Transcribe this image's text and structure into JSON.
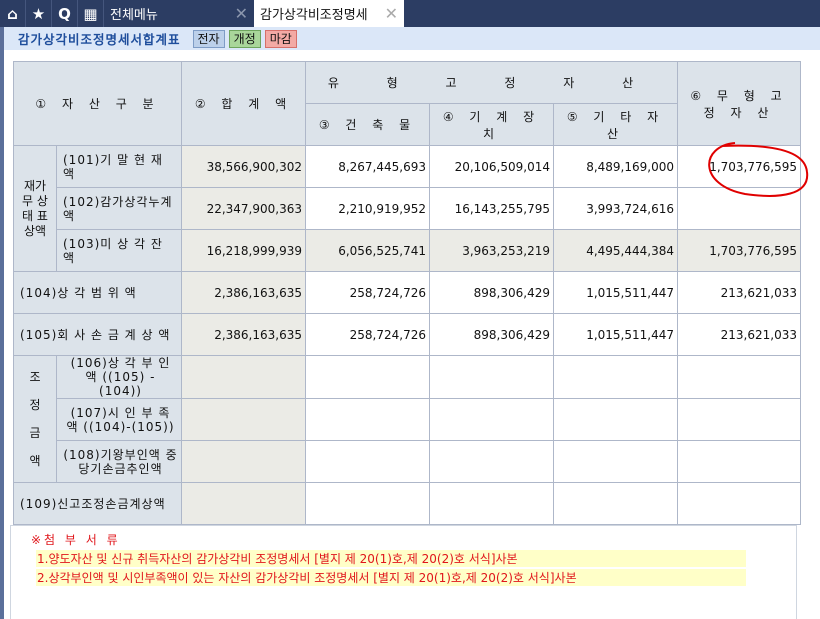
{
  "tabbar": {
    "home_icon": "home-icon",
    "star_icon": "star-icon",
    "search_glyph": "Q",
    "menu_tab": "전체메뉴",
    "active_tab": "감가상각비조정명세",
    "close": "✕"
  },
  "header": {
    "title": "감가상각비조정명세서합계표",
    "btn_e": "전자",
    "btn_revise": "개정",
    "btn_close": "마감"
  },
  "table": {
    "h_asset": "① 자 산 구 분",
    "h_total": "② 합 계 액",
    "h_tangible": "유 형 고 정 자 산",
    "h_intangible": "⑥ 무 형 고 정 자 산",
    "h_building": "③ 건 축 물",
    "h_machine": "④ 기 계 장 치",
    "h_other": "⑤ 기 타 자 산",
    "group_bs": "재가 무 상 태 표 상액",
    "group_adj": "조정 금액",
    "rows": [
      {
        "label": "(101)기 말 현 재 액",
        "total": "38,566,900,302",
        "building": "8,267,445,693",
        "machine": "20,106,509,014",
        "other": "8,489,169,000",
        "intangible": "1,703,776,595"
      },
      {
        "label": "(102)감가상각누계액",
        "total": "22,347,900,363",
        "building": "2,210,919,952",
        "machine": "16,143,255,795",
        "other": "3,993,724,616",
        "intangible": ""
      },
      {
        "label": "(103)미 상 각 잔 액",
        "total": "16,218,999,939",
        "building": "6,056,525,741",
        "machine": "3,963,253,219",
        "other": "4,495,444,384",
        "intangible": "1,703,776,595"
      },
      {
        "label": "(104)상 각 범 위 액",
        "total": "2,386,163,635",
        "building": "258,724,726",
        "machine": "898,306,429",
        "other": "1,015,511,447",
        "intangible": "213,621,033"
      },
      {
        "label": "(105)회 사 손 금 계 상 액",
        "total": "2,386,163,635",
        "building": "258,724,726",
        "machine": "898,306,429",
        "other": "1,015,511,447",
        "intangible": "213,621,033"
      },
      {
        "label": "(106)상 각 부 인 액 ((105) - (104))",
        "total": "",
        "building": "",
        "machine": "",
        "other": "",
        "intangible": ""
      },
      {
        "label": "(107)시 인 부 족 액 ((104)-(105))",
        "total": "",
        "building": "",
        "machine": "",
        "other": "",
        "intangible": ""
      },
      {
        "label": "(108)기왕부인액 중 당기손금추인액",
        "total": "",
        "building": "",
        "machine": "",
        "other": "",
        "intangible": ""
      },
      {
        "label": "(109)신고조정손금계상액",
        "total": "",
        "building": "",
        "machine": "",
        "other": "",
        "intangible": ""
      }
    ]
  },
  "notes": {
    "title": "※첨 부 서 류",
    "lines": [
      "1.양도자산 및 신규 취득자산의 감가상각비 조정명세서 [별지 제 20(1)호,제 20(2)호 서식]사본",
      "2.상각부인액 및 시인부족액이 있는 자산의 감가상각비 조정명세서 [별지 제 20(1)호,제 20(2)호 서식]사본"
    ]
  },
  "colors": {
    "annotation": "#e00000",
    "nav": "#2c3d63"
  }
}
